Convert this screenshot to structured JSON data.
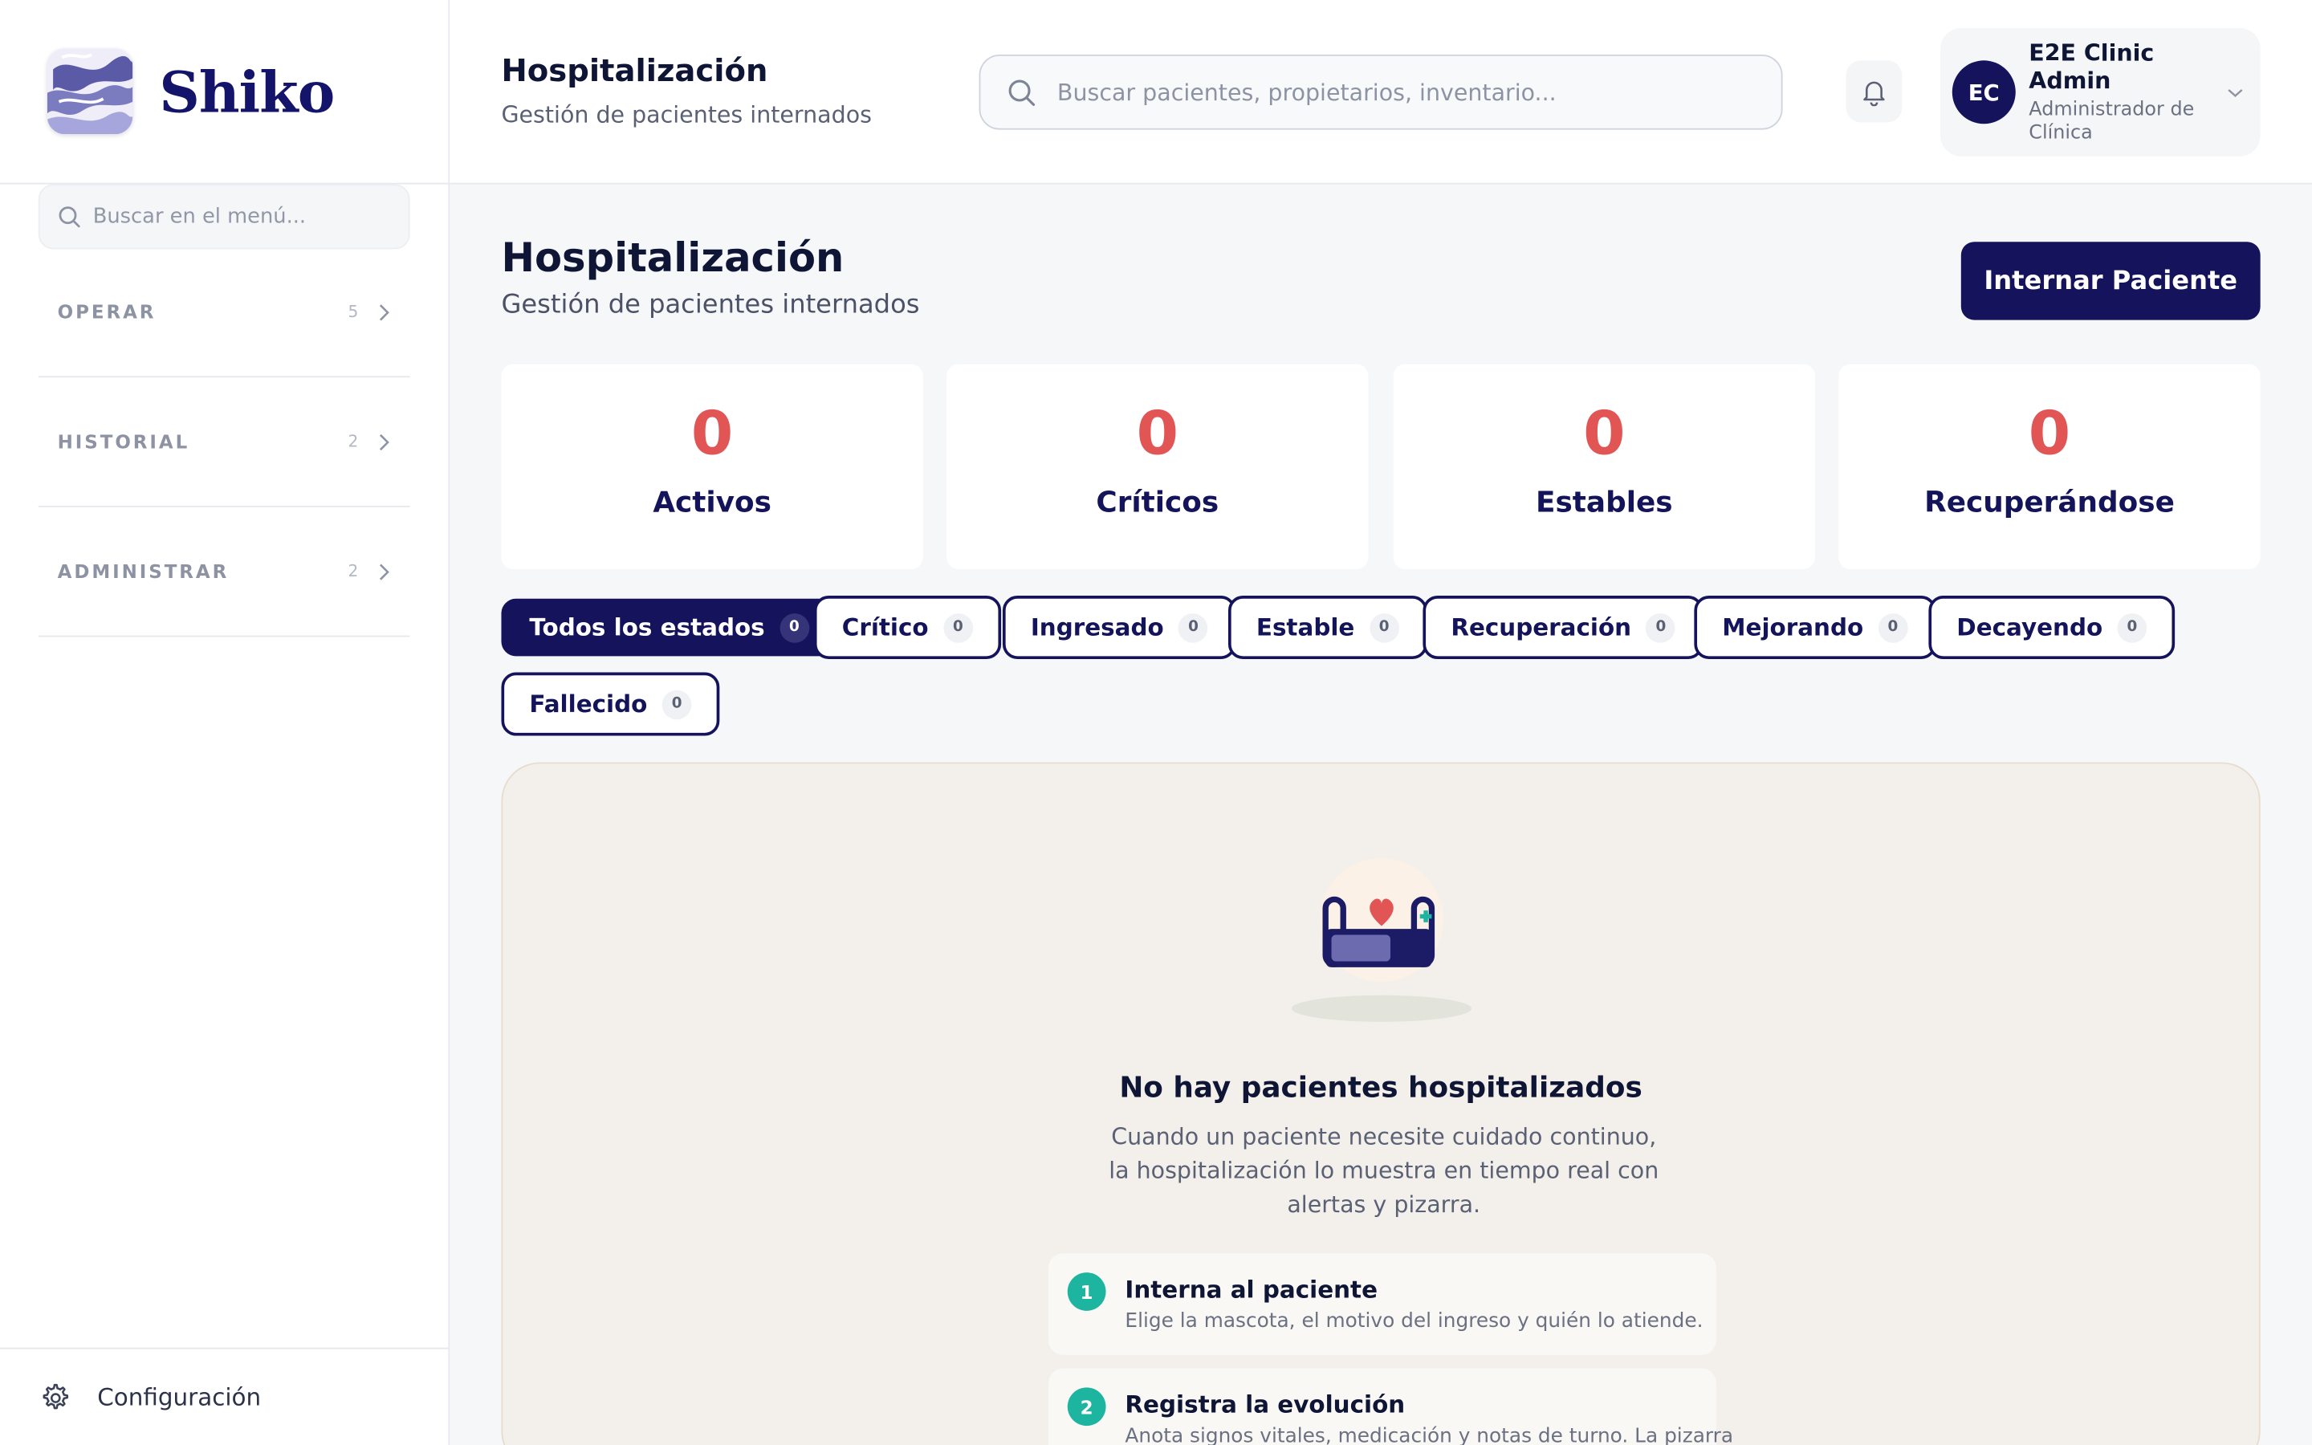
{
  "brand": {
    "name": "Shiko"
  },
  "sidebar": {
    "search_placeholder": "Buscar en el menú...",
    "sections": [
      {
        "label": "OPERAR",
        "count": "5"
      },
      {
        "label": "HISTORIAL",
        "count": "2"
      },
      {
        "label": "ADMINISTRAR",
        "count": "2"
      }
    ],
    "settings_label": "Configuración"
  },
  "header": {
    "title": "Hospitalización",
    "subtitle": "Gestión de pacientes internados",
    "search_placeholder": "Buscar pacientes, propietarios, inventario...",
    "user": {
      "initials": "EC",
      "name": "E2E Clinic Admin",
      "role": "Administrador de Clínica"
    }
  },
  "main": {
    "title": "Hospitalización",
    "subtitle": "Gestión de pacientes internados",
    "primary_action": "Internar Paciente",
    "stats": [
      {
        "value": "0",
        "label": "Activos"
      },
      {
        "value": "0",
        "label": "Críticos"
      },
      {
        "value": "0",
        "label": "Estables"
      },
      {
        "value": "0",
        "label": "Recuperándose"
      }
    ],
    "filters": [
      {
        "label": "Todos los estados",
        "count": "0",
        "active": true
      },
      {
        "label": "Crítico",
        "count": "0"
      },
      {
        "label": "Ingresado",
        "count": "0"
      },
      {
        "label": "Estable",
        "count": "0"
      },
      {
        "label": "Recuperación",
        "count": "0"
      },
      {
        "label": "Mejorando",
        "count": "0"
      },
      {
        "label": "Decayendo",
        "count": "0"
      },
      {
        "label": "Fallecido",
        "count": "0"
      }
    ],
    "empty_state": {
      "title": "No hay pacientes hospitalizados",
      "description": "Cuando un paciente necesite cuidado continuo, la hospitalización lo muestra en tiempo real con alertas y pizarra.",
      "steps": [
        {
          "number": "1",
          "title": "Interna al paciente",
          "description": "Elige la mascota, el motivo del ingreso y quién lo atiende."
        },
        {
          "number": "2",
          "title": "Registra la evolución",
          "description": "Anota signos vitales, medicación y notas de turno. La pizarra"
        }
      ]
    }
  },
  "colors": {
    "brand_navy": "#14135c",
    "stat_value": "#e25555",
    "step_badge": "#1db5a0",
    "empty_panel_bg": "#f3efea"
  }
}
